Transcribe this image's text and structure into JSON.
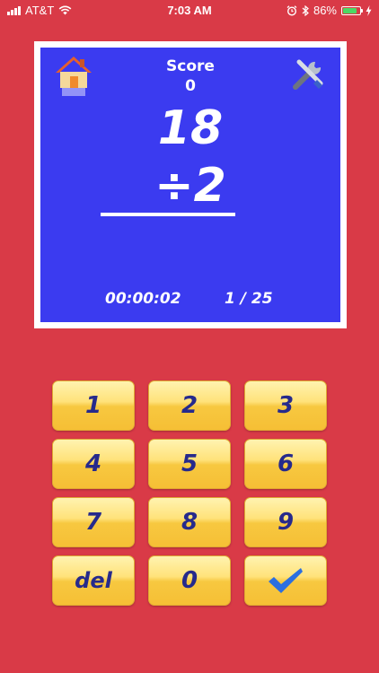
{
  "status_bar": {
    "carrier": "AT&T",
    "time": "7:03 AM",
    "battery": "86%",
    "battery_level": 0.86
  },
  "header": {
    "score_label": "Score",
    "score_value": "0"
  },
  "problem": {
    "dividend": "18",
    "divisor": "÷2"
  },
  "footer": {
    "timer": "00:00:02",
    "progress": "1 / 25"
  },
  "icons": {
    "home": "home-icon",
    "settings": "tools-icon",
    "submit": "checkmark-icon"
  },
  "colors": {
    "background": "#d93a47",
    "panel": "#3b3bf0",
    "key_text": "#262a8c",
    "key_top": "#fff3b0",
    "key_bottom": "#f6bf35",
    "check": "#2b6fe0"
  },
  "keypad": {
    "keys": [
      "1",
      "2",
      "3",
      "4",
      "5",
      "6",
      "7",
      "8",
      "9",
      "del",
      "0",
      ""
    ]
  }
}
